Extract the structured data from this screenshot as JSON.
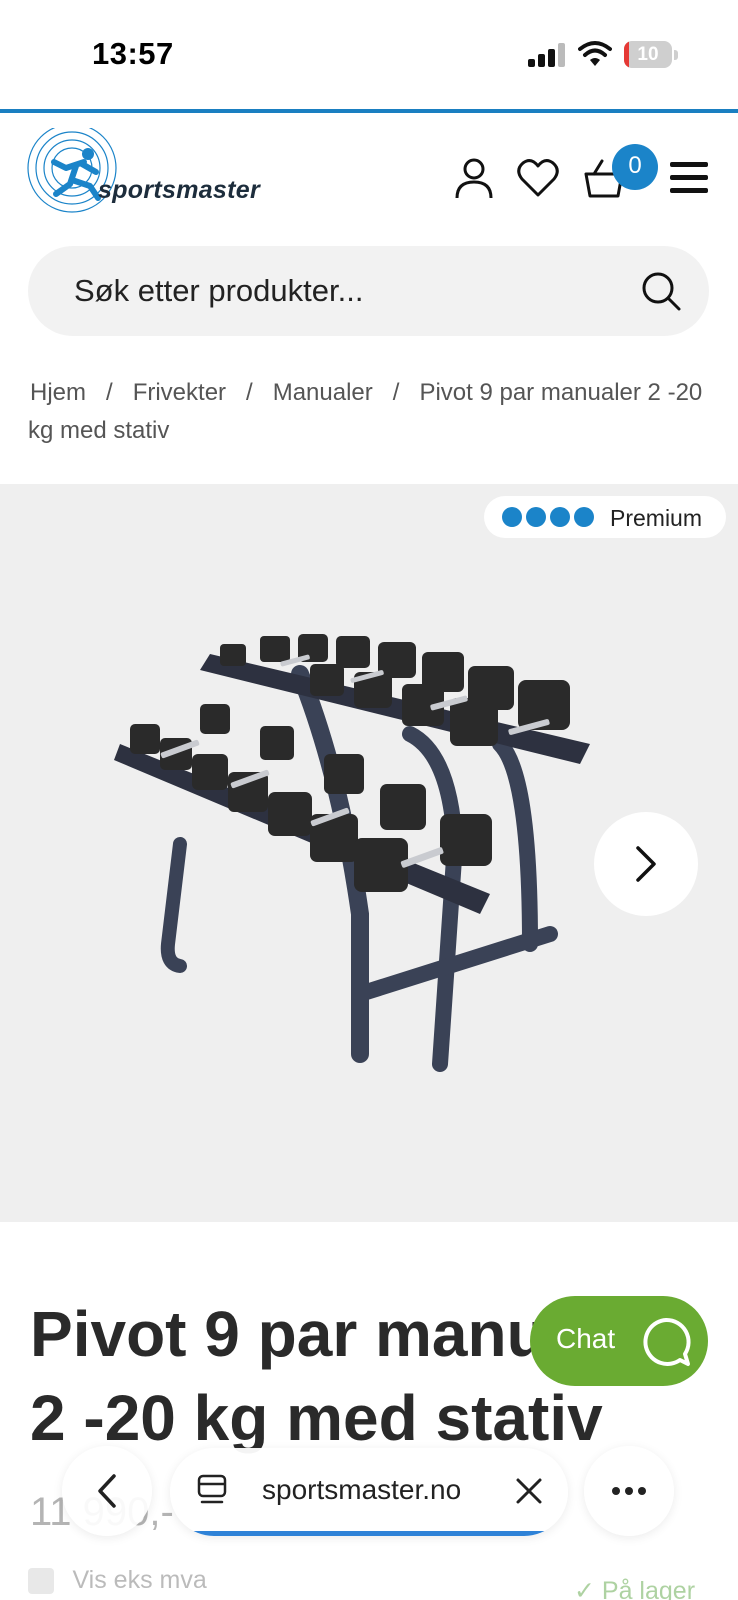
{
  "status_bar": {
    "time": "13:57",
    "battery_level": "10",
    "signal_bars": 3
  },
  "header": {
    "logo_text": "sportsmaster",
    "cart_count": "0",
    "accent_color": "#1b84c9",
    "icons": [
      "account-icon",
      "heart-icon",
      "cart-icon",
      "menu-icon"
    ]
  },
  "search": {
    "placeholder": "Søk etter produkter..."
  },
  "breadcrumb": {
    "items": [
      "Hjem",
      "Frivekter",
      "Manualer",
      "Pivot 9 par manualer 2 -20 kg med stativ"
    ],
    "separator": "/"
  },
  "gallery": {
    "badge_label": "Premium",
    "badge_dots": 4
  },
  "product": {
    "title": "Pivot 9 par manualer 2 -20 kg med stativ",
    "price": "11 990,-",
    "eks_mva_label": "Vis eks mva",
    "stock_label": "På lager"
  },
  "chat": {
    "label": "Chat",
    "color": "#6aab32"
  },
  "browser": {
    "url": "sportsmaster.no"
  }
}
